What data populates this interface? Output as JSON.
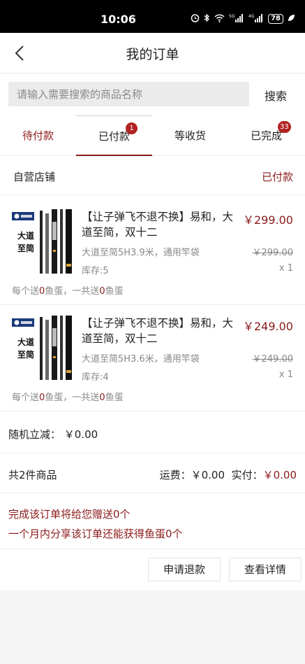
{
  "status_bar": {
    "time": "10:06",
    "icons": [
      "alarm-icon",
      "bluetooth-icon",
      "wifi-icon",
      "5g-signal-icon",
      "4g-signal-icon",
      "battery-icon",
      "leaf-icon"
    ],
    "signal_5g": "5G",
    "signal_4g": "4G",
    "battery": "78"
  },
  "header": {
    "title": "我的订单",
    "back_icon": "chevron-left-icon"
  },
  "search": {
    "placeholder": "请输入需要搜索的商品名称",
    "button_label": "搜索"
  },
  "tabs": [
    {
      "label": "待付款",
      "badge": ""
    },
    {
      "label": "已付款",
      "badge": "1"
    },
    {
      "label": "等收货",
      "badge": ""
    },
    {
      "label": "已完成",
      "badge": "33"
    }
  ],
  "order": {
    "shop_name": "自营店铺",
    "status": "已付款",
    "items": [
      {
        "name": "【让子弹飞不退不换】易和，大道至简，双十二",
        "spec": "大道至简5H3.9米，通用竿袋",
        "stock": "库存:5",
        "price": "￥299.00",
        "original_price": "￥299.00",
        "quantity": "x 1",
        "gift_prefix": "每个送",
        "gift_count": "0",
        "gift_mid": "鱼蛋，一共送",
        "gift_total": "0",
        "gift_suffix": "鱼蛋",
        "thumb_text": "大道至简"
      },
      {
        "name": "【让子弹飞不退不换】易和，大道至简，双十二",
        "spec": "大道至简5H3.6米，通用竿袋",
        "stock": "库存:4",
        "price": "￥249.00",
        "original_price": "￥249.00",
        "quantity": "x 1",
        "gift_prefix": "每个送",
        "gift_count": "0",
        "gift_mid": "鱼蛋，一共送",
        "gift_total": "0",
        "gift_suffix": "鱼蛋",
        "thumb_text": "大道至简"
      }
    ],
    "random_discount": "随机立减： ￥0.00",
    "item_count": "共2件商品",
    "shipping_label": "运费：",
    "shipping": "￥0.00",
    "paid_label": "实付：",
    "paid": "￥0.00",
    "reward_line1": "完成该订单将给您赠送0个",
    "reward_line2": "一个月内分享该订单还能获得鱼蛋0个"
  },
  "actions": {
    "refund": "申请退款",
    "details": "查看详情"
  },
  "colors": {
    "accent": "#8b1a1a",
    "badge": "#b22222",
    "muted": "#888888"
  }
}
